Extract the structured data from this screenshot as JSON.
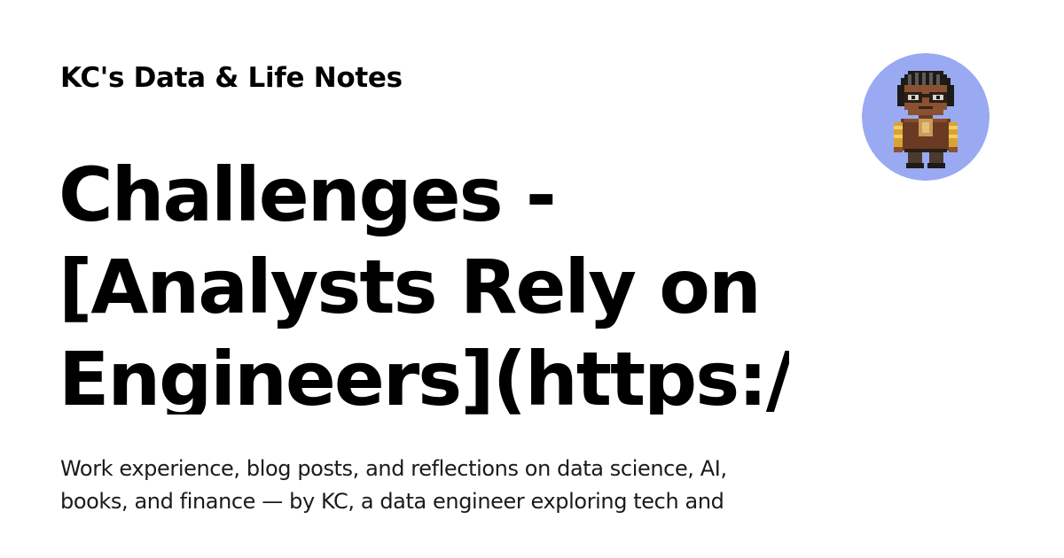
{
  "card": {
    "site_name": "KC's Data & Life Notes",
    "title_lines": [
      "Challenges -",
      "[Analysts Rely on",
      "Engineers](https://a"
    ],
    "description_lines": [
      "Work experience, blog posts, and reflections on data science, AI,",
      "books, and finance — by KC, a data engineer exploring tech and"
    ],
    "avatar": {
      "icon": "pixel-art-character-icon",
      "background_color": "#9aaaf2"
    }
  }
}
